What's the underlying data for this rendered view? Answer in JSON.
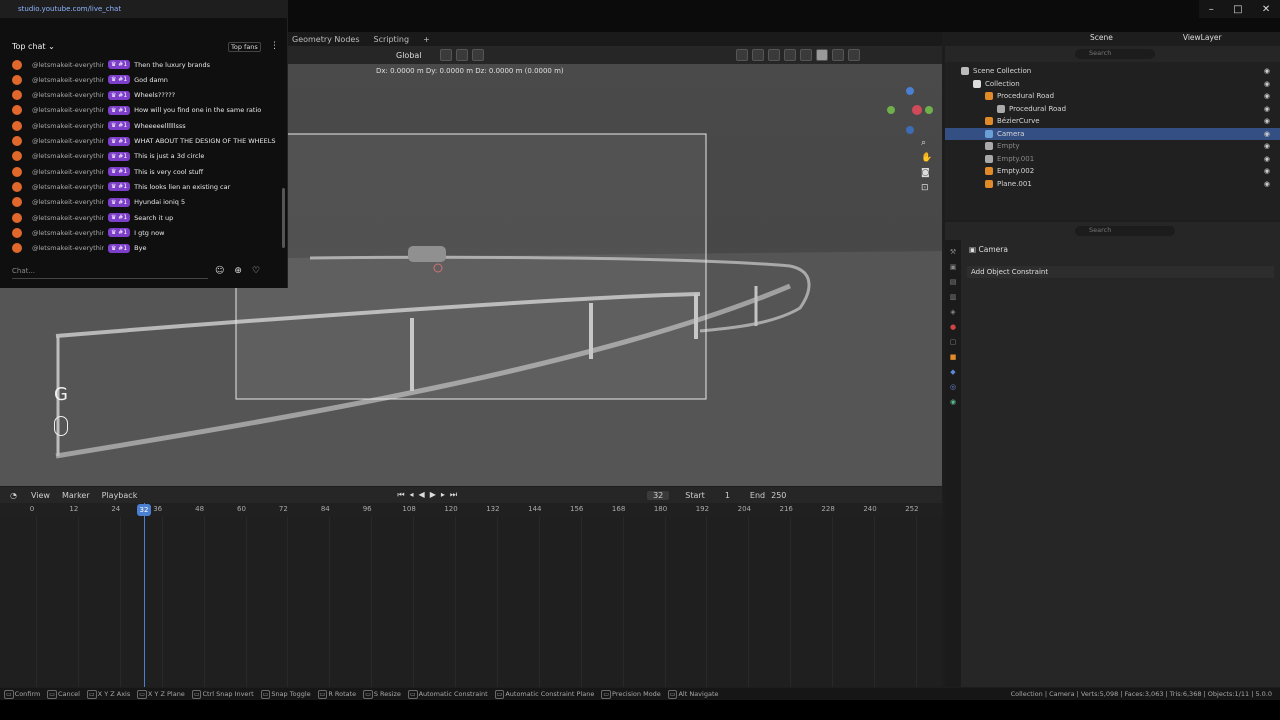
{
  "browser": {
    "url": "studio.youtube.com/live_chat"
  },
  "chat": {
    "header": "Top chat",
    "top_fans_label": "Top fans",
    "input_placeholder": "Chat...",
    "messages": [
      {
        "user": "@letsmakeit-everything",
        "badge": "#1",
        "text": "Then the luxury brands"
      },
      {
        "user": "@letsmakeit-everything",
        "badge": "#1",
        "text": "God damn"
      },
      {
        "user": "@letsmakeit-everything",
        "badge": "#1",
        "text": "Wheels?????"
      },
      {
        "user": "@letsmakeit-everything",
        "badge": "#1",
        "text": "How will you find one in the same ratio"
      },
      {
        "user": "@letsmakeit-everything",
        "badge": "#1",
        "text": "Wheeeeellllllsss"
      },
      {
        "user": "@letsmakeit-everything",
        "badge": "#1",
        "text": "WHAT ABOUT THE DESIGN OF THE WHEELS"
      },
      {
        "user": "@letsmakeit-everything",
        "badge": "#1",
        "text": "This is just a 3d circle"
      },
      {
        "user": "@letsmakeit-everything",
        "badge": "#1",
        "text": "This is very cool stuff"
      },
      {
        "user": "@letsmakeit-everything",
        "badge": "#1",
        "text": "This looks lien an existing car"
      },
      {
        "user": "@letsmakeit-everything",
        "badge": "#1",
        "text": "Hyundai ioniq 5"
      },
      {
        "user": "@letsmakeit-everything",
        "badge": "#1",
        "text": "Search it up"
      },
      {
        "user": "@letsmakeit-everything",
        "badge": "#1",
        "text": "I gtg now"
      },
      {
        "user": "@letsmakeit-everything",
        "badge": "#1",
        "text": "Bye"
      }
    ]
  },
  "workspaces": [
    "Geometry Nodes",
    "Scripting",
    "+"
  ],
  "viewport": {
    "orientation": "Global",
    "transform_readout": "Dx: 0.0000 m  Dy: 0.0000 m  Dz: 0.0000 m (0.0000 m)",
    "key_overlay": "G"
  },
  "timeline": {
    "menus": [
      "View",
      "Marker",
      "Playback"
    ],
    "current_frame": "32",
    "start_label": "Start",
    "start": "1",
    "end_label": "End",
    "end": "250",
    "playhead": "32",
    "ticks": [
      "0",
      "12",
      "24",
      "36",
      "48",
      "60",
      "72",
      "84",
      "96",
      "108",
      "120",
      "132",
      "144",
      "156",
      "168",
      "180",
      "192",
      "204",
      "216",
      "228",
      "240",
      "252"
    ]
  },
  "outliner": {
    "scene": "Scene",
    "view_layer": "ViewLayer",
    "search_placeholder": "Search",
    "rows": [
      {
        "label": "Scene Collection",
        "indent": 0
      },
      {
        "label": "Collection",
        "indent": 1
      },
      {
        "label": "Procedural Road",
        "indent": 2
      },
      {
        "label": "Procedural Road",
        "indent": 3
      },
      {
        "label": "BézierCurve",
        "indent": 2
      },
      {
        "label": "Camera",
        "indent": 2
      },
      {
        "label": "Empty",
        "indent": 2
      },
      {
        "label": "Empty.001",
        "indent": 2
      },
      {
        "label": "Empty.002",
        "indent": 2
      },
      {
        "label": "Plane.001",
        "indent": 2
      }
    ]
  },
  "properties": {
    "search_placeholder": "Search",
    "object_name": "Camera",
    "add_constraint": "Add Object Constraint"
  },
  "status": {
    "items": [
      "Confirm",
      "Cancel",
      "X Y Z Axis",
      "X Y Z Plane",
      "Ctrl Snap Invert",
      "Snap Toggle",
      "R Rotate",
      "S Resize",
      "Automatic Constraint",
      "Automatic Constraint Plane",
      "Precision Mode",
      "Alt Navigate"
    ],
    "right": "Collection | Camera | Verts:5,098 | Faces:3,063 | Tris:6,368 | Objects:1/11 | 5.0.0"
  },
  "colors": {
    "selection": "#334f84",
    "badge": "#7d3fc9",
    "avatar": "#e0682c",
    "playhead": "#4a7fd1"
  }
}
